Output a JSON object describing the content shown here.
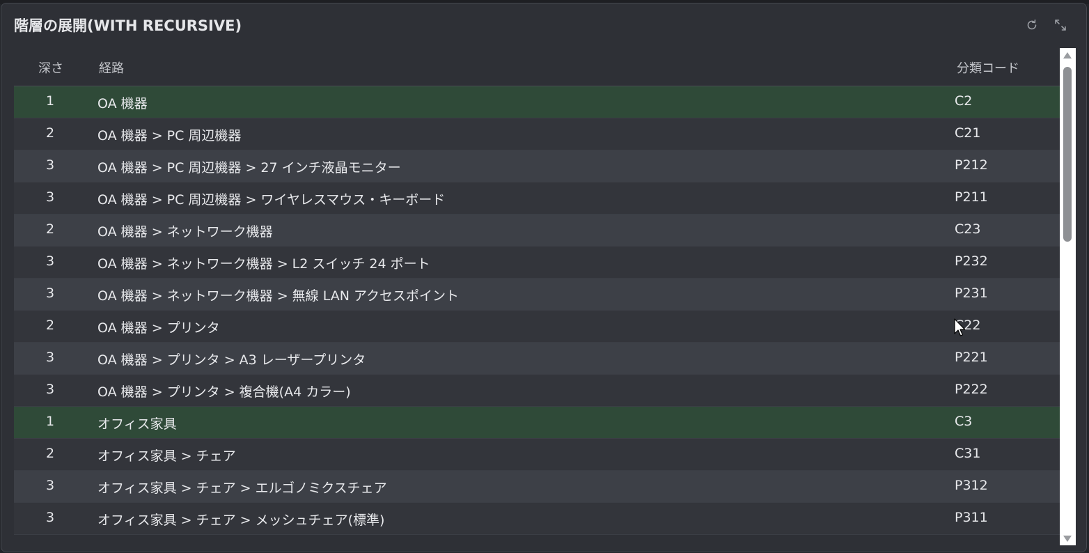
{
  "window": {
    "title": "階層の展開(WITH RECURSIVE)",
    "refresh_icon": "refresh-icon",
    "expand_icon": "expand-icon"
  },
  "columns": {
    "depth": "深さ",
    "path": "経路",
    "code": "分類コード"
  },
  "rows": [
    {
      "depth": "1",
      "path": "OA 機器",
      "code": "C2"
    },
    {
      "depth": "2",
      "path": "OA 機器 > PC 周辺機器",
      "code": "C21"
    },
    {
      "depth": "3",
      "path": "OA 機器 > PC 周辺機器 > 27 インチ液晶モニター",
      "code": "P212"
    },
    {
      "depth": "3",
      "path": "OA 機器 > PC 周辺機器 > ワイヤレスマウス・キーボード",
      "code": "P211"
    },
    {
      "depth": "2",
      "path": "OA 機器 > ネットワーク機器",
      "code": "C23"
    },
    {
      "depth": "3",
      "path": "OA 機器 > ネットワーク機器 > L2 スイッチ 24 ポート",
      "code": "P232"
    },
    {
      "depth": "3",
      "path": "OA 機器 > ネットワーク機器 > 無線 LAN アクセスポイント",
      "code": "P231"
    },
    {
      "depth": "2",
      "path": "OA 機器 > プリンタ",
      "code": "C22"
    },
    {
      "depth": "3",
      "path": "OA 機器 > プリンタ > A3 レーザープリンタ",
      "code": "P221"
    },
    {
      "depth": "3",
      "path": "OA 機器 > プリンタ > 複合機(A4 カラー)",
      "code": "P222"
    },
    {
      "depth": "1",
      "path": "オフィス家具",
      "code": "C3"
    },
    {
      "depth": "2",
      "path": "オフィス家具 > チェア",
      "code": "C31"
    },
    {
      "depth": "3",
      "path": "オフィス家具 > チェア > エルゴノミクスチェア",
      "code": "P312"
    },
    {
      "depth": "3",
      "path": "オフィス家具 > チェア > メッシュチェア(標準)",
      "code": "P311"
    }
  ],
  "colors": {
    "highlight_row": "#2f4a38",
    "row": "#33353b",
    "row_alt": "#3d4047",
    "panel": "#2e3036"
  }
}
